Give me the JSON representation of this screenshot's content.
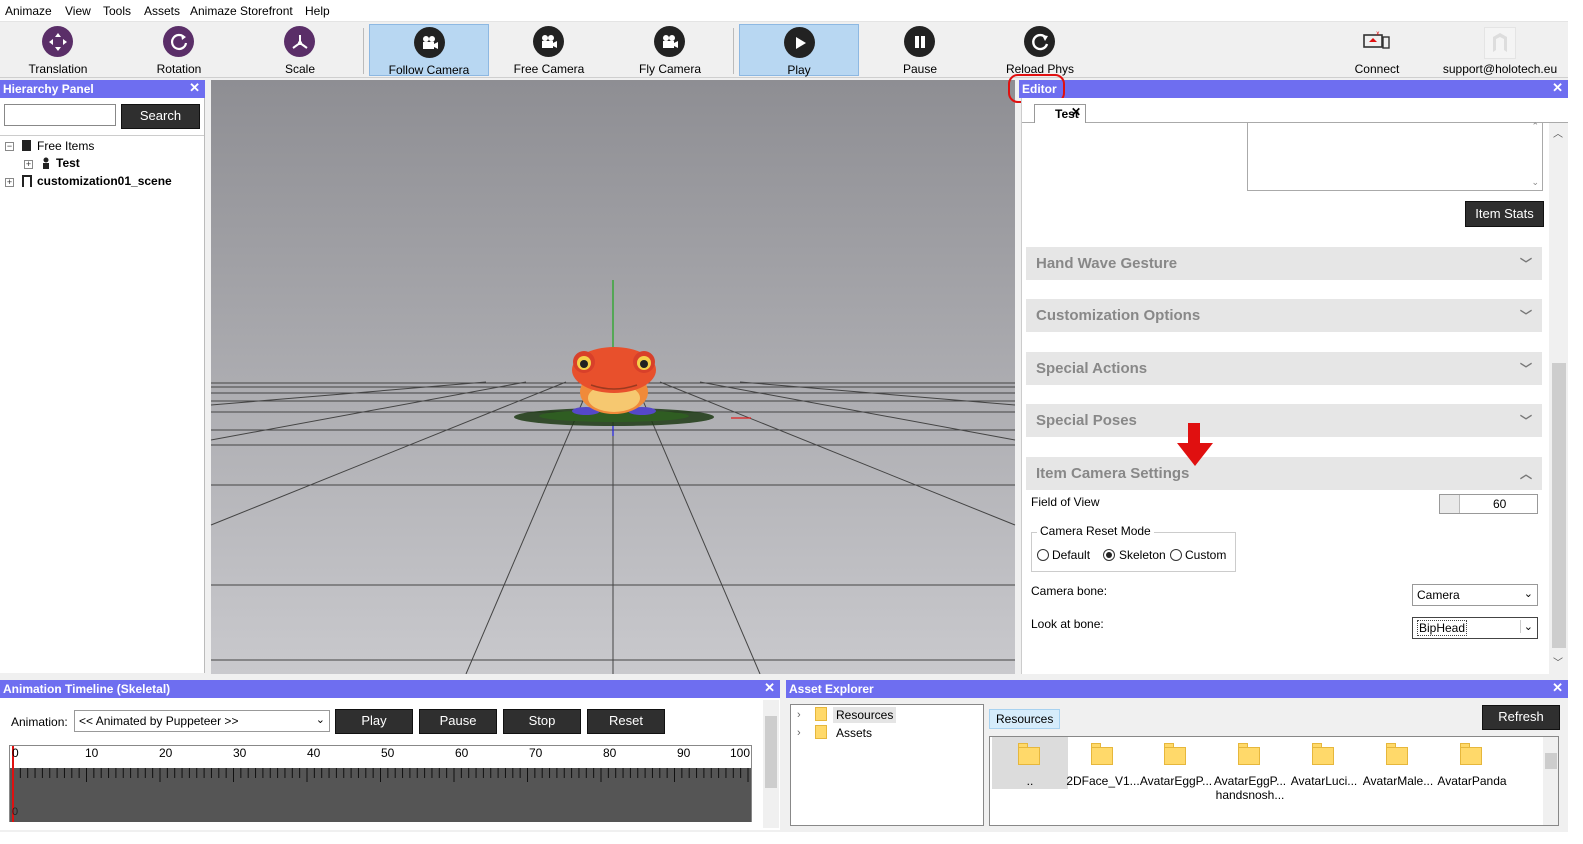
{
  "menu": [
    "Animaze",
    "View",
    "Tools",
    "Assets",
    "Animaze Storefront",
    "Help"
  ],
  "toolbar": {
    "translation": "Translation",
    "rotation": "Rotation",
    "scale": "Scale",
    "follow_camera": "Follow Camera",
    "free_camera": "Free Camera",
    "fly_camera": "Fly Camera",
    "play": "Play",
    "pause": "Pause",
    "reload_phys": "Reload Phys",
    "connect": "Connect",
    "support": "support@holotech.eu"
  },
  "hierarchy": {
    "title": "Hierarchy Panel",
    "search_button": "Search",
    "search_value": "",
    "items": [
      "Free Items",
      "Test",
      "customization01_scene"
    ]
  },
  "editor": {
    "title": "Editor",
    "tab": "Test",
    "item_stats_button": "Item Stats",
    "sections": [
      "Hand Wave Gesture",
      "Customization Options",
      "Special Actions",
      "Special Poses",
      "Item Camera Settings"
    ],
    "fov_label": "Field of View",
    "fov_value": "60",
    "reset_mode_label": "Camera Reset Mode",
    "reset_modes": [
      "Default",
      "Skeleton",
      "Custom"
    ],
    "reset_mode_selected": "Skeleton",
    "camera_bone_label": "Camera bone:",
    "camera_bone_value": "Camera",
    "look_bone_label": "Look at bone:",
    "look_bone_value": "BipHead"
  },
  "timeline": {
    "title": "Animation Timeline (Skeletal)",
    "animation_label": "Animation:",
    "animation_value": "<< Animated by Puppeteer >>",
    "play": "Play",
    "pause": "Pause",
    "stop": "Stop",
    "reset": "Reset",
    "ticks": [
      "0",
      "10",
      "20",
      "30",
      "40",
      "50",
      "60",
      "70",
      "80",
      "90",
      "100"
    ],
    "cursor_value": "0"
  },
  "assets": {
    "title": "Asset Explorer",
    "tree": [
      "Resources",
      "Assets"
    ],
    "breadcrumb": "Resources",
    "refresh": "Refresh",
    "files": [
      "..",
      "2DFace_V1...",
      "AvatarEggP...",
      "AvatarEggP... handsnosh...",
      "AvatarLuci...",
      "AvatarMale...",
      "AvatarPanda"
    ]
  },
  "colors": {
    "panel_title": "#6e6ef0",
    "accent_purple": "#5a2e68",
    "highlight_red": "#e01010"
  }
}
